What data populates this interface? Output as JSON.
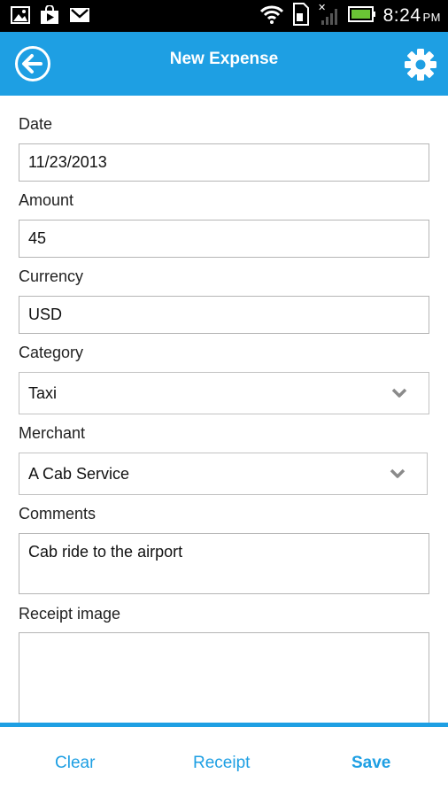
{
  "status_bar": {
    "time": "8:24",
    "ampm": "PM",
    "icons": [
      "gallery-icon",
      "play-store-icon",
      "gmail-icon",
      "wifi-icon",
      "sim-icon",
      "no-signal-icon",
      "battery-icon"
    ]
  },
  "action_bar": {
    "title": "New Expense",
    "back_icon": "back-arrow-icon",
    "settings_icon": "gear-icon",
    "accent_color": "#1e9fe3"
  },
  "form": {
    "date": {
      "label": "Date",
      "value": "11/23/2013"
    },
    "amount": {
      "label": "Amount",
      "value": "45"
    },
    "currency": {
      "label": "Currency",
      "value": "USD"
    },
    "category": {
      "label": "Category",
      "value": "Taxi"
    },
    "merchant": {
      "label": "Merchant",
      "value": "A Cab Service"
    },
    "comments": {
      "label": "Comments",
      "value": "Cab ride to the airport"
    },
    "receipt_image": {
      "label": "Receipt image"
    }
  },
  "bottom_bar": {
    "clear": "Clear",
    "receipt": "Receipt",
    "save": "Save"
  }
}
